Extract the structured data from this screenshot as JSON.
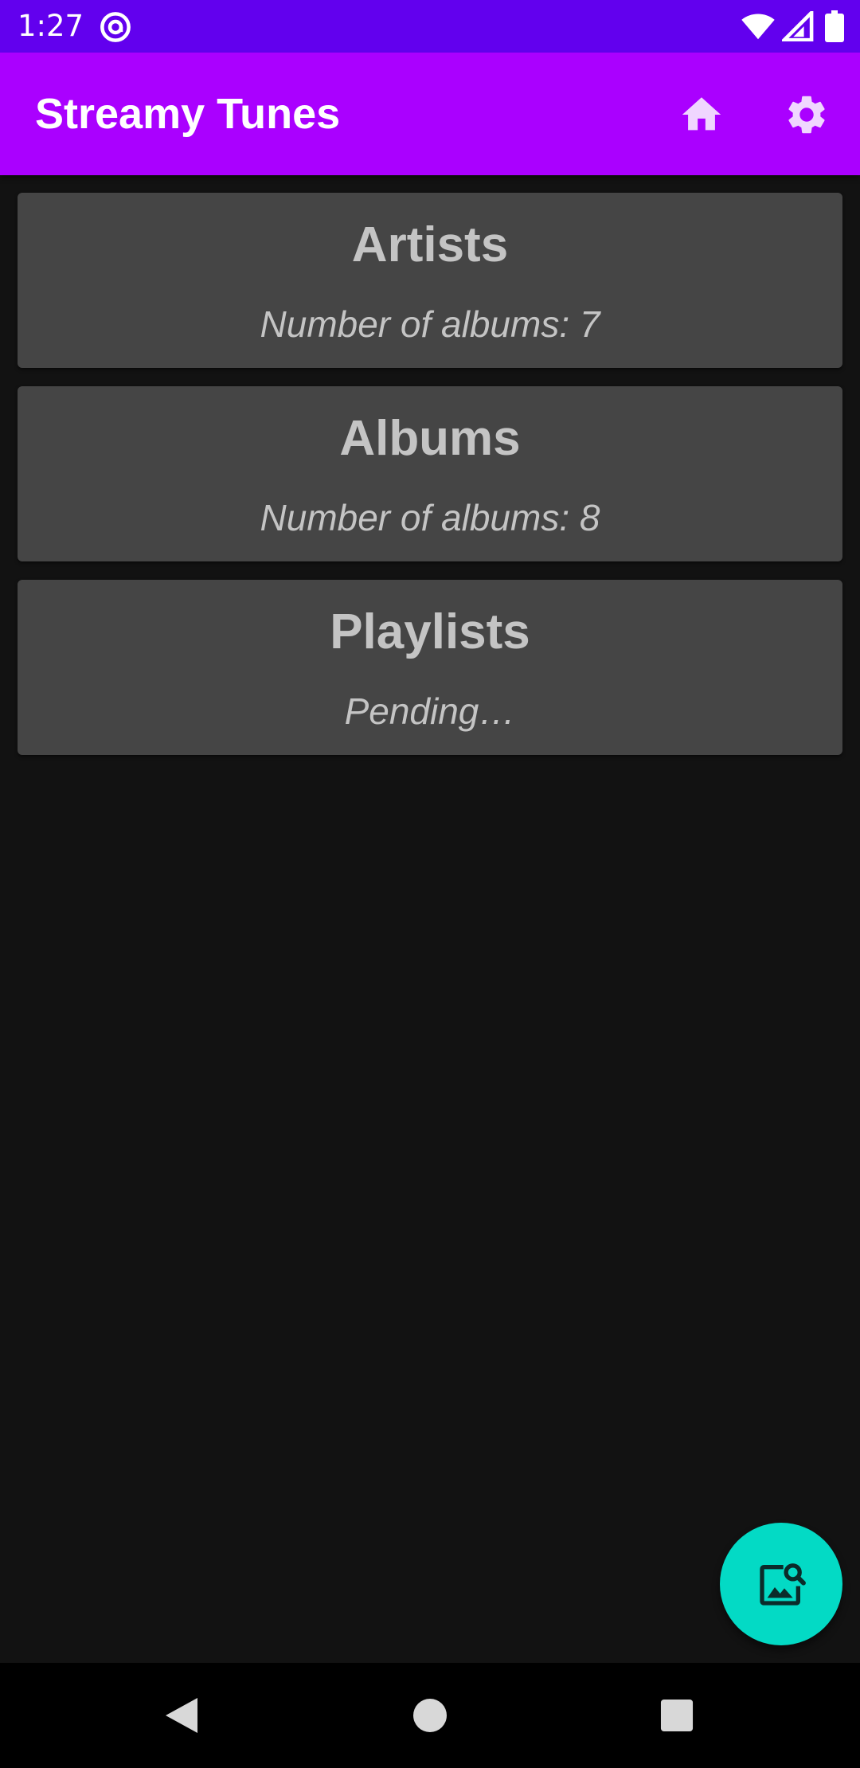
{
  "status_bar": {
    "time": "1:27",
    "icons": [
      "at-sign-icon",
      "wifi-icon",
      "signal-icon",
      "battery-icon"
    ],
    "background": "#6200ee"
  },
  "app_bar": {
    "title": "Streamy Tunes",
    "background": "#aa00ff",
    "actions": [
      "home-icon",
      "gear-icon"
    ]
  },
  "cards": [
    {
      "title": "Artists",
      "subtitle": "Number of albums: 7"
    },
    {
      "title": "Albums",
      "subtitle": "Number of albums: 8"
    },
    {
      "title": "Playlists",
      "subtitle": "Pending…"
    }
  ],
  "fab": {
    "icon": "image-search-icon",
    "color": "#03dac5"
  },
  "nav_bar": {
    "buttons": [
      "back-icon",
      "home-circle-icon",
      "recents-icon"
    ]
  },
  "colors": {
    "background": "#121212",
    "card": "#454545",
    "card_text": "#c4c4c4"
  }
}
